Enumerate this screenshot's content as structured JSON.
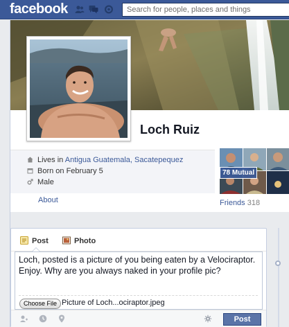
{
  "topbar": {
    "logo": "facebook",
    "search_placeholder": "Search for people, places and things",
    "jewels": [
      "friend-requests-icon",
      "messages-icon",
      "notifications-icon"
    ]
  },
  "profile": {
    "name": "Loch Ruiz",
    "info": {
      "lives_prefix": "Lives in ",
      "lives_place": "Antigua Guatemala, Sacatepequez",
      "born": "Born on February 5",
      "gender": "Male"
    },
    "about_label": "About",
    "friends": {
      "label": "Friends",
      "count": "318",
      "mutual": "78 Mutual"
    }
  },
  "composer": {
    "tabs": [
      {
        "label": "Post",
        "icon": "status-icon"
      },
      {
        "label": "Photo",
        "icon": "photo-icon"
      }
    ],
    "text": "Loch, posted is a picture of you being eaten by a Velociraptor. Enjoy. Why are you always naked in your profile pic?",
    "choose_file_label": "Choose File",
    "file_name": "Picture of Loch...ociraptor.jpeg",
    "post_label": "Post"
  },
  "colors": {
    "brand": "#3b5998",
    "link": "#3b5998",
    "post_button": "#5b74a8"
  }
}
